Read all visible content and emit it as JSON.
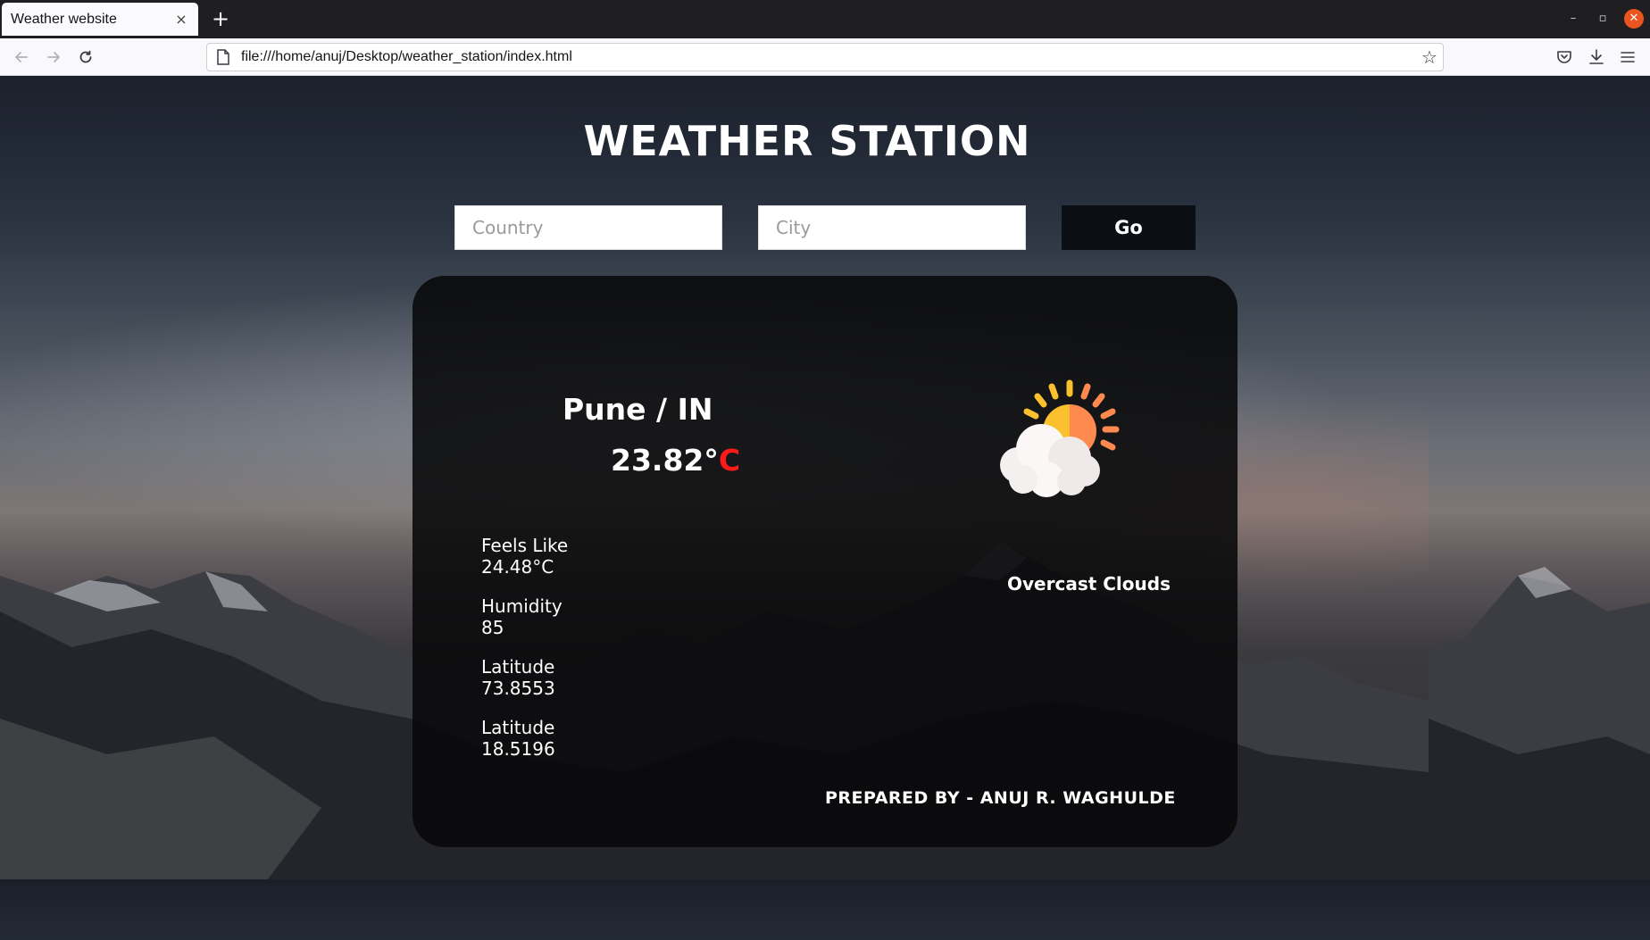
{
  "browser": {
    "tab_title": "Weather website",
    "tab_close": "×",
    "new_tab": "+",
    "url": "file:///home/anuj/Desktop/weather_station/index.html",
    "back_icon": "arrow-left-icon",
    "forward_icon": "arrow-right-icon",
    "reload_icon": "reload-icon",
    "window_minimize": "–",
    "window_restore": "▫",
    "window_close": "✕"
  },
  "page": {
    "title": "WEATHER STATION",
    "country_placeholder": "Country",
    "city_placeholder": "City",
    "go_label": "Go"
  },
  "weather": {
    "location": "Pune / IN",
    "temperature": "23.82°",
    "temperature_unit": "C",
    "feels_like_label": "Feels Like",
    "feels_like_value": "24.48°C",
    "humidity_label": "Humidity",
    "humidity_value": "85",
    "latitude_label_1": "Latitude",
    "latitude_value_1": "73.8553",
    "latitude_label_2": "Latitude",
    "latitude_value_2": "18.5196",
    "description": "Overcast Clouds",
    "icon": "partly-cloudy-icon"
  },
  "footer": {
    "credit": "PREPARED BY - ANUJ R. WAGHULDE"
  },
  "colors": {
    "accent_unit": "#ff1a1a",
    "card_bg": "#080809",
    "button_bg": "#0b0e14",
    "sun_yellow": "#fbc02d",
    "sun_orange": "#ff8a50"
  }
}
